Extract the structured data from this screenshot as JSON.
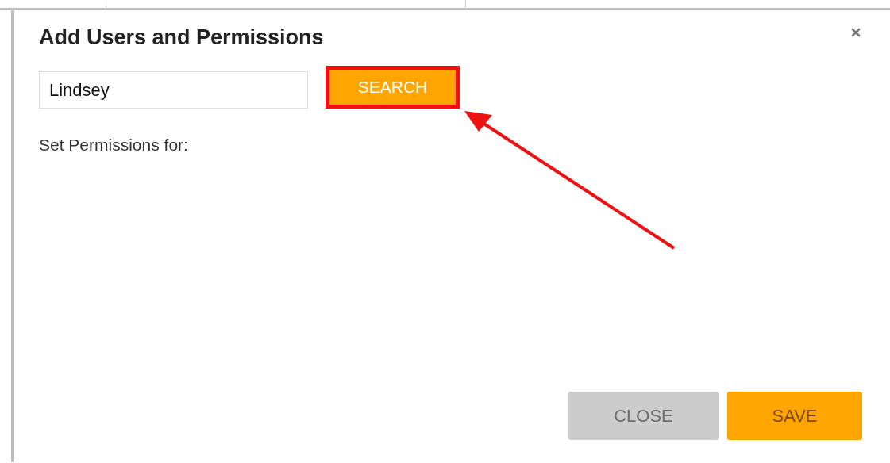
{
  "dialog": {
    "title": "Add Users and Permissions",
    "search_field": {
      "value": "Lindsey"
    },
    "search_button": {
      "label": "SEARCH",
      "highlighted": true
    },
    "permissions_label": "Set Permissions for:",
    "buttons": [
      {
        "label": "CLOSE",
        "disabled": true
      },
      {
        "label": "SAVE",
        "disabled": false
      }
    ]
  }
}
